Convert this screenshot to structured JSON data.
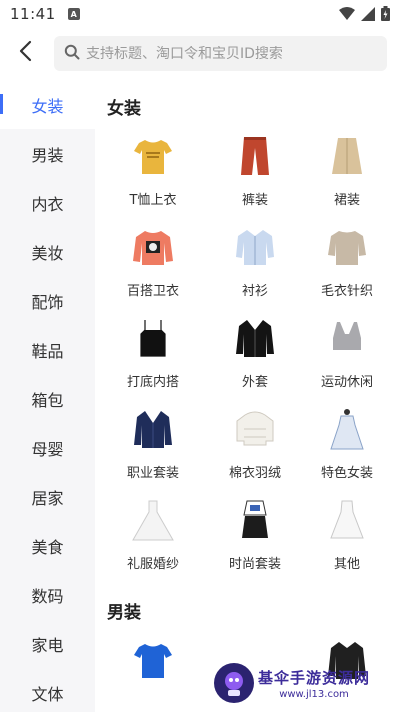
{
  "status_bar": {
    "time": "11:41",
    "app_badge": "A",
    "icons": [
      "wifi-icon",
      "signal-icon",
      "battery-icon"
    ]
  },
  "search": {
    "back_icon": "chevron-left-icon",
    "placeholder": "支持标题、淘口令和宝贝ID搜索",
    "value": ""
  },
  "sidebar": {
    "accent_color": "#3d6ef7",
    "items": [
      {
        "label": "女装",
        "active": true
      },
      {
        "label": "男装"
      },
      {
        "label": "内衣"
      },
      {
        "label": "美妆"
      },
      {
        "label": "配饰"
      },
      {
        "label": "鞋品"
      },
      {
        "label": "箱包"
      },
      {
        "label": "母婴"
      },
      {
        "label": "居家"
      },
      {
        "label": "美食"
      },
      {
        "label": "数码"
      },
      {
        "label": "家电"
      },
      {
        "label": "文体"
      }
    ]
  },
  "sections": [
    {
      "title": "女装",
      "items": [
        {
          "label": "T恤上衣",
          "icon": "tshirt-icon"
        },
        {
          "label": "裤装",
          "icon": "pants-icon"
        },
        {
          "label": "裙装",
          "icon": "skirt-icon"
        },
        {
          "label": "百搭卫衣",
          "icon": "sweatshirt-icon"
        },
        {
          "label": "衬衫",
          "icon": "shirt-icon"
        },
        {
          "label": "毛衣针织",
          "icon": "sweater-icon"
        },
        {
          "label": "打底内搭",
          "icon": "camisole-icon"
        },
        {
          "label": "外套",
          "icon": "jacket-icon"
        },
        {
          "label": "运动休闲",
          "icon": "sports-bra-icon"
        },
        {
          "label": "职业套装",
          "icon": "blazer-icon"
        },
        {
          "label": "棉衣羽绒",
          "icon": "down-jacket-icon"
        },
        {
          "label": "特色女装",
          "icon": "hanfu-dress-icon"
        },
        {
          "label": "礼服婚纱",
          "icon": "wedding-dress-icon"
        },
        {
          "label": "时尚套装",
          "icon": "outfit-set-icon"
        },
        {
          "label": "其他",
          "icon": "white-dress-icon"
        }
      ]
    },
    {
      "title": "男装",
      "items": [
        {
          "label": "",
          "icon": "mens-tshirt-icon"
        },
        {
          "label": "",
          "icon": "mens-item-icon"
        },
        {
          "label": "",
          "icon": "mens-jacket-icon"
        }
      ]
    }
  ],
  "watermark": {
    "name": "基伞手游资源网",
    "url": "www.jl13.com"
  }
}
